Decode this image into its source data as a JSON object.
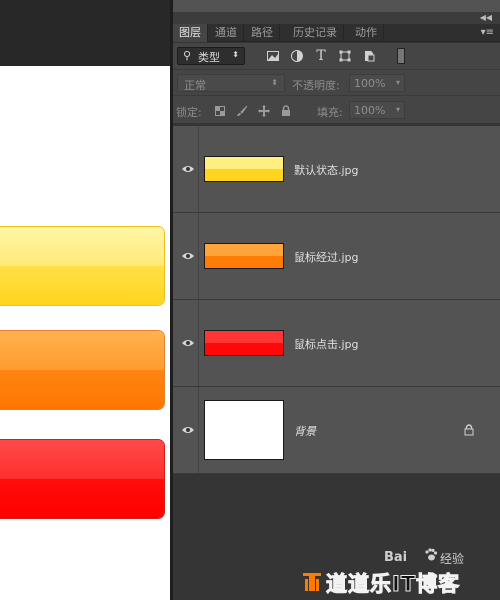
{
  "canvas": {
    "buttons": [
      {
        "name": "yellow",
        "color": "#ffd41c"
      },
      {
        "name": "orange",
        "color": "#ff7700"
      },
      {
        "name": "red",
        "color": "#ff0000"
      }
    ]
  },
  "panel": {
    "collapse_icon": "collapse-double-chevron-icon",
    "menu_icon": "panel-menu-icon",
    "tabs": [
      {
        "label": "图层",
        "active": true
      },
      {
        "label": "通道",
        "active": false
      },
      {
        "label": "路径",
        "active": false
      },
      {
        "label": "历史记录",
        "active": false
      },
      {
        "label": "动作",
        "active": false
      }
    ],
    "filter": {
      "kind_label": "类型",
      "icons": [
        "image-icon",
        "adjustment-icon",
        "type-icon",
        "shape-icon",
        "smart-object-icon"
      ]
    },
    "blend": {
      "mode": "正常",
      "opacity_label": "不透明度:",
      "opacity_value": "100%"
    },
    "lock": {
      "label": "锁定:",
      "icons": [
        "lock-transparent-icon",
        "lock-brush-icon",
        "lock-move-icon",
        "lock-all-icon"
      ],
      "fill_label": "填充:",
      "fill_value": "100%"
    },
    "layers": [
      {
        "name": "默认状态.jpg",
        "visible": true,
        "thumb_top": "#ffef7e",
        "thumb_bottom": "#ffd520"
      },
      {
        "name": "鼠标经过.jpg",
        "visible": true,
        "thumb_top": "#ffa43a",
        "thumb_bottom": "#ff7c06"
      },
      {
        "name": "鼠标点击.jpg",
        "visible": true,
        "thumb_top": "#ff3434",
        "thumb_bottom": "#ff0808"
      },
      {
        "name": "背景",
        "visible": true,
        "thumb_top": "#ffffff",
        "thumb_bottom": "#ffffff",
        "locked": true
      }
    ]
  },
  "watermark": {
    "baidu": "Bai",
    "jingyan": "经验",
    "site": "道道乐IT博客"
  }
}
